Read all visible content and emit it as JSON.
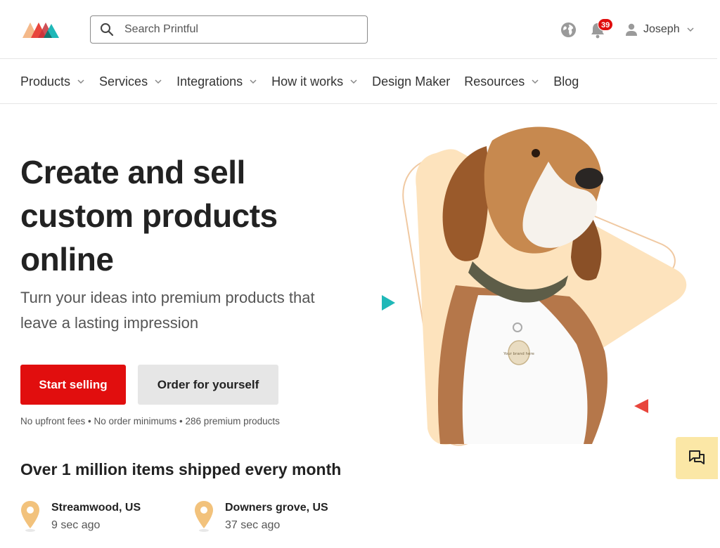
{
  "header": {
    "search_placeholder": "Search Printful",
    "notifications_count": "39",
    "user_name": "Joseph"
  },
  "nav": {
    "items": [
      {
        "label": "Products",
        "has_dropdown": true
      },
      {
        "label": "Services",
        "has_dropdown": true
      },
      {
        "label": "Integrations",
        "has_dropdown": true
      },
      {
        "label": "How it works",
        "has_dropdown": true
      },
      {
        "label": "Design Maker",
        "has_dropdown": false
      },
      {
        "label": "Resources",
        "has_dropdown": true
      },
      {
        "label": "Blog",
        "has_dropdown": false
      }
    ]
  },
  "hero": {
    "title": "Create and sell custom products online",
    "subtitle": "Turn your ideas into premium products that leave a lasting impression",
    "primary_button": "Start selling",
    "secondary_button": "Order for yourself",
    "note": "No upfront fees • No order minimums • 286 premium products",
    "tag_text": "Your brand here"
  },
  "shipped": {
    "title": "Over 1 million items shipped every month",
    "locations": [
      {
        "city": "Streamwood, US",
        "ago": "9 sec ago"
      },
      {
        "city": "Downers grove, US",
        "ago": "37 sec ago"
      }
    ]
  },
  "icons": {
    "search": "search-icon",
    "globe": "globe-icon",
    "bell": "bell-icon",
    "user": "person-icon",
    "chat": "chat-icon",
    "pin": "map-pin-icon"
  },
  "colors": {
    "brand_red": "#e10e0e",
    "teal": "#1fb8b8",
    "peach": "#fde3bd",
    "pin": "#f2c27c",
    "chat_bg": "#fbe7a6"
  }
}
